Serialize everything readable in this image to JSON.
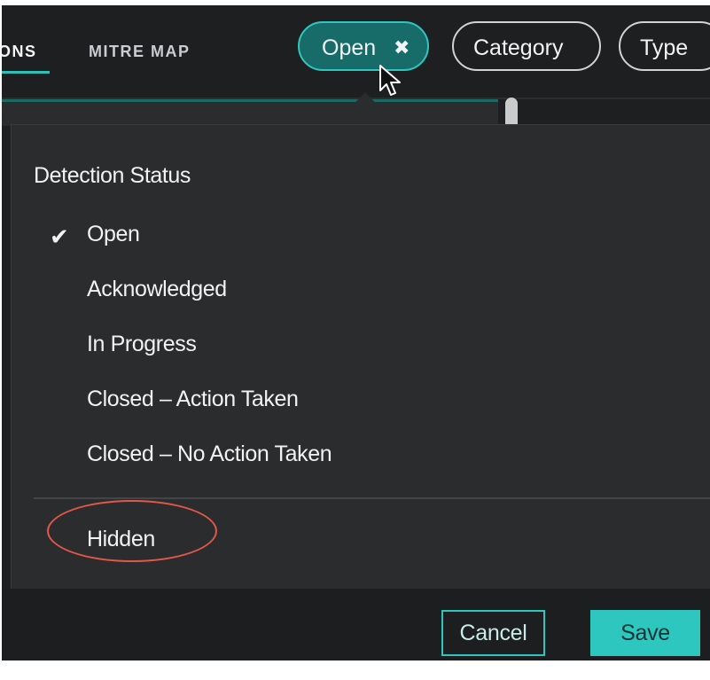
{
  "nav": {
    "tabs": [
      {
        "label": "ONS",
        "active": true
      },
      {
        "label": "MITRE MAP",
        "active": false
      }
    ]
  },
  "filters": {
    "open_label": "Open",
    "open_remove_icon": "close-icon",
    "category_label": "Category",
    "type_label": "Type"
  },
  "dropdown": {
    "title": "Detection Status",
    "options": [
      {
        "label": "Open",
        "checked": true
      },
      {
        "label": "Acknowledged",
        "checked": false
      },
      {
        "label": "In Progress",
        "checked": false
      },
      {
        "label": "Closed – Action Taken",
        "checked": false
      },
      {
        "label": "Closed – No Action Taken",
        "checked": false
      }
    ],
    "extra_option": {
      "label": "Hidden",
      "checked": false
    },
    "check_icon": "checkmark-icon"
  },
  "footer": {
    "cancel_label": "Cancel",
    "save_label": "Save"
  },
  "colors": {
    "accent": "#2ec7bf",
    "active_pill_bg": "#176c69",
    "panel_bg": "#2b2c2d",
    "annotation": "#e2574a"
  }
}
